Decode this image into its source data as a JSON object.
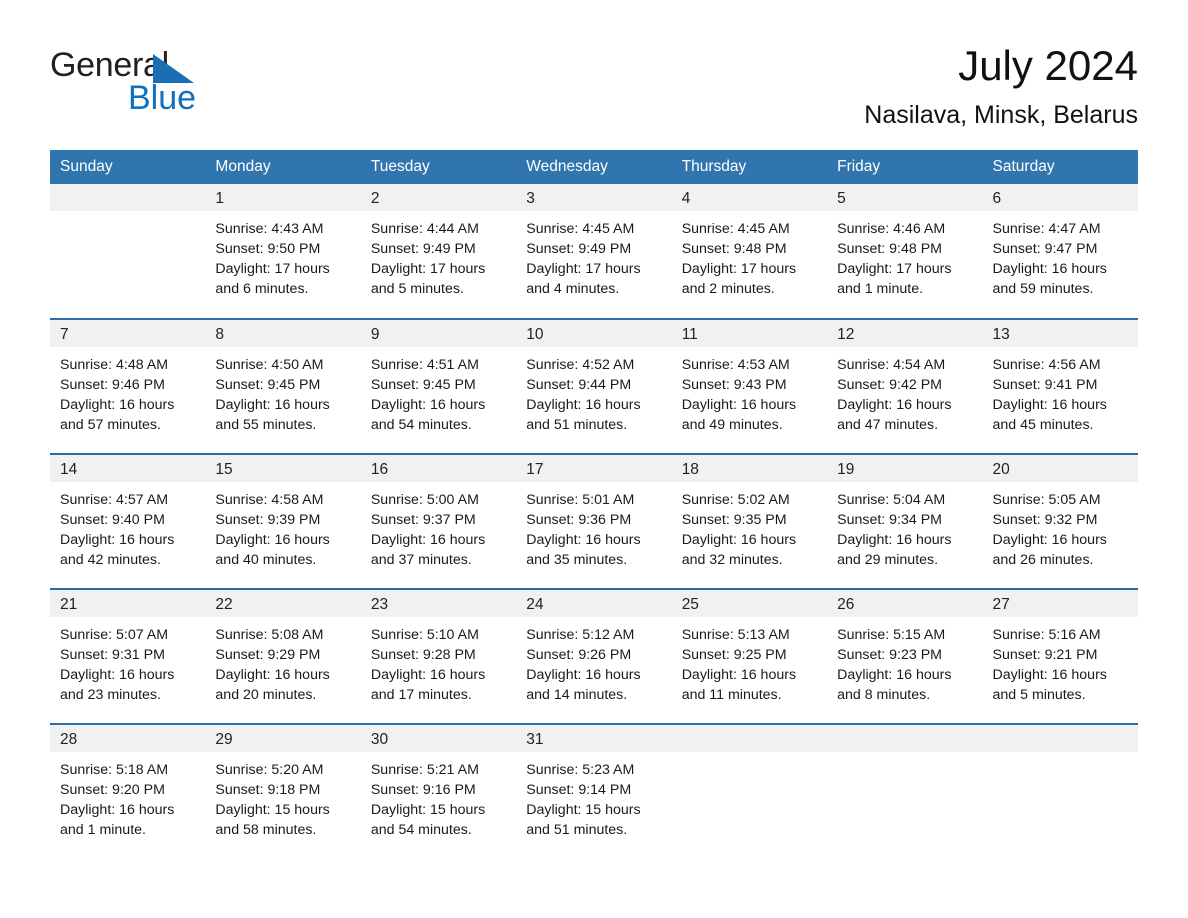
{
  "brand": {
    "name_part1": "General",
    "name_part2": "Blue",
    "triangle_color": "#1a6fb4",
    "blue_color": "#1170c0"
  },
  "header": {
    "title": "July 2024",
    "location": "Nasilava, Minsk, Belarus"
  },
  "theme": {
    "header_blue": "#3175ae",
    "row_border_blue": "#2e6da4",
    "daynum_bg": "#f1f1f1"
  },
  "weekdays": [
    "Sunday",
    "Monday",
    "Tuesday",
    "Wednesday",
    "Thursday",
    "Friday",
    "Saturday"
  ],
  "weeks": [
    [
      {
        "day": "",
        "sunrise": "",
        "sunset": "",
        "daylight_line1": "",
        "daylight_line2": ""
      },
      {
        "day": "1",
        "sunrise": "Sunrise: 4:43 AM",
        "sunset": "Sunset: 9:50 PM",
        "daylight_line1": "Daylight: 17 hours",
        "daylight_line2": "and 6 minutes."
      },
      {
        "day": "2",
        "sunrise": "Sunrise: 4:44 AM",
        "sunset": "Sunset: 9:49 PM",
        "daylight_line1": "Daylight: 17 hours",
        "daylight_line2": "and 5 minutes."
      },
      {
        "day": "3",
        "sunrise": "Sunrise: 4:45 AM",
        "sunset": "Sunset: 9:49 PM",
        "daylight_line1": "Daylight: 17 hours",
        "daylight_line2": "and 4 minutes."
      },
      {
        "day": "4",
        "sunrise": "Sunrise: 4:45 AM",
        "sunset": "Sunset: 9:48 PM",
        "daylight_line1": "Daylight: 17 hours",
        "daylight_line2": "and 2 minutes."
      },
      {
        "day": "5",
        "sunrise": "Sunrise: 4:46 AM",
        "sunset": "Sunset: 9:48 PM",
        "daylight_line1": "Daylight: 17 hours",
        "daylight_line2": "and 1 minute."
      },
      {
        "day": "6",
        "sunrise": "Sunrise: 4:47 AM",
        "sunset": "Sunset: 9:47 PM",
        "daylight_line1": "Daylight: 16 hours",
        "daylight_line2": "and 59 minutes."
      }
    ],
    [
      {
        "day": "7",
        "sunrise": "Sunrise: 4:48 AM",
        "sunset": "Sunset: 9:46 PM",
        "daylight_line1": "Daylight: 16 hours",
        "daylight_line2": "and 57 minutes."
      },
      {
        "day": "8",
        "sunrise": "Sunrise: 4:50 AM",
        "sunset": "Sunset: 9:45 PM",
        "daylight_line1": "Daylight: 16 hours",
        "daylight_line2": "and 55 minutes."
      },
      {
        "day": "9",
        "sunrise": "Sunrise: 4:51 AM",
        "sunset": "Sunset: 9:45 PM",
        "daylight_line1": "Daylight: 16 hours",
        "daylight_line2": "and 54 minutes."
      },
      {
        "day": "10",
        "sunrise": "Sunrise: 4:52 AM",
        "sunset": "Sunset: 9:44 PM",
        "daylight_line1": "Daylight: 16 hours",
        "daylight_line2": "and 51 minutes."
      },
      {
        "day": "11",
        "sunrise": "Sunrise: 4:53 AM",
        "sunset": "Sunset: 9:43 PM",
        "daylight_line1": "Daylight: 16 hours",
        "daylight_line2": "and 49 minutes."
      },
      {
        "day": "12",
        "sunrise": "Sunrise: 4:54 AM",
        "sunset": "Sunset: 9:42 PM",
        "daylight_line1": "Daylight: 16 hours",
        "daylight_line2": "and 47 minutes."
      },
      {
        "day": "13",
        "sunrise": "Sunrise: 4:56 AM",
        "sunset": "Sunset: 9:41 PM",
        "daylight_line1": "Daylight: 16 hours",
        "daylight_line2": "and 45 minutes."
      }
    ],
    [
      {
        "day": "14",
        "sunrise": "Sunrise: 4:57 AM",
        "sunset": "Sunset: 9:40 PM",
        "daylight_line1": "Daylight: 16 hours",
        "daylight_line2": "and 42 minutes."
      },
      {
        "day": "15",
        "sunrise": "Sunrise: 4:58 AM",
        "sunset": "Sunset: 9:39 PM",
        "daylight_line1": "Daylight: 16 hours",
        "daylight_line2": "and 40 minutes."
      },
      {
        "day": "16",
        "sunrise": "Sunrise: 5:00 AM",
        "sunset": "Sunset: 9:37 PM",
        "daylight_line1": "Daylight: 16 hours",
        "daylight_line2": "and 37 minutes."
      },
      {
        "day": "17",
        "sunrise": "Sunrise: 5:01 AM",
        "sunset": "Sunset: 9:36 PM",
        "daylight_line1": "Daylight: 16 hours",
        "daylight_line2": "and 35 minutes."
      },
      {
        "day": "18",
        "sunrise": "Sunrise: 5:02 AM",
        "sunset": "Sunset: 9:35 PM",
        "daylight_line1": "Daylight: 16 hours",
        "daylight_line2": "and 32 minutes."
      },
      {
        "day": "19",
        "sunrise": "Sunrise: 5:04 AM",
        "sunset": "Sunset: 9:34 PM",
        "daylight_line1": "Daylight: 16 hours",
        "daylight_line2": "and 29 minutes."
      },
      {
        "day": "20",
        "sunrise": "Sunrise: 5:05 AM",
        "sunset": "Sunset: 9:32 PM",
        "daylight_line1": "Daylight: 16 hours",
        "daylight_line2": "and 26 minutes."
      }
    ],
    [
      {
        "day": "21",
        "sunrise": "Sunrise: 5:07 AM",
        "sunset": "Sunset: 9:31 PM",
        "daylight_line1": "Daylight: 16 hours",
        "daylight_line2": "and 23 minutes."
      },
      {
        "day": "22",
        "sunrise": "Sunrise: 5:08 AM",
        "sunset": "Sunset: 9:29 PM",
        "daylight_line1": "Daylight: 16 hours",
        "daylight_line2": "and 20 minutes."
      },
      {
        "day": "23",
        "sunrise": "Sunrise: 5:10 AM",
        "sunset": "Sunset: 9:28 PM",
        "daylight_line1": "Daylight: 16 hours",
        "daylight_line2": "and 17 minutes."
      },
      {
        "day": "24",
        "sunrise": "Sunrise: 5:12 AM",
        "sunset": "Sunset: 9:26 PM",
        "daylight_line1": "Daylight: 16 hours",
        "daylight_line2": "and 14 minutes."
      },
      {
        "day": "25",
        "sunrise": "Sunrise: 5:13 AM",
        "sunset": "Sunset: 9:25 PM",
        "daylight_line1": "Daylight: 16 hours",
        "daylight_line2": "and 11 minutes."
      },
      {
        "day": "26",
        "sunrise": "Sunrise: 5:15 AM",
        "sunset": "Sunset: 9:23 PM",
        "daylight_line1": "Daylight: 16 hours",
        "daylight_line2": "and 8 minutes."
      },
      {
        "day": "27",
        "sunrise": "Sunrise: 5:16 AM",
        "sunset": "Sunset: 9:21 PM",
        "daylight_line1": "Daylight: 16 hours",
        "daylight_line2": "and 5 minutes."
      }
    ],
    [
      {
        "day": "28",
        "sunrise": "Sunrise: 5:18 AM",
        "sunset": "Sunset: 9:20 PM",
        "daylight_line1": "Daylight: 16 hours",
        "daylight_line2": "and 1 minute."
      },
      {
        "day": "29",
        "sunrise": "Sunrise: 5:20 AM",
        "sunset": "Sunset: 9:18 PM",
        "daylight_line1": "Daylight: 15 hours",
        "daylight_line2": "and 58 minutes."
      },
      {
        "day": "30",
        "sunrise": "Sunrise: 5:21 AM",
        "sunset": "Sunset: 9:16 PM",
        "daylight_line1": "Daylight: 15 hours",
        "daylight_line2": "and 54 minutes."
      },
      {
        "day": "31",
        "sunrise": "Sunrise: 5:23 AM",
        "sunset": "Sunset: 9:14 PM",
        "daylight_line1": "Daylight: 15 hours",
        "daylight_line2": "and 51 minutes."
      },
      {
        "day": "",
        "sunrise": "",
        "sunset": "",
        "daylight_line1": "",
        "daylight_line2": ""
      },
      {
        "day": "",
        "sunrise": "",
        "sunset": "",
        "daylight_line1": "",
        "daylight_line2": ""
      },
      {
        "day": "",
        "sunrise": "",
        "sunset": "",
        "daylight_line1": "",
        "daylight_line2": ""
      }
    ]
  ]
}
